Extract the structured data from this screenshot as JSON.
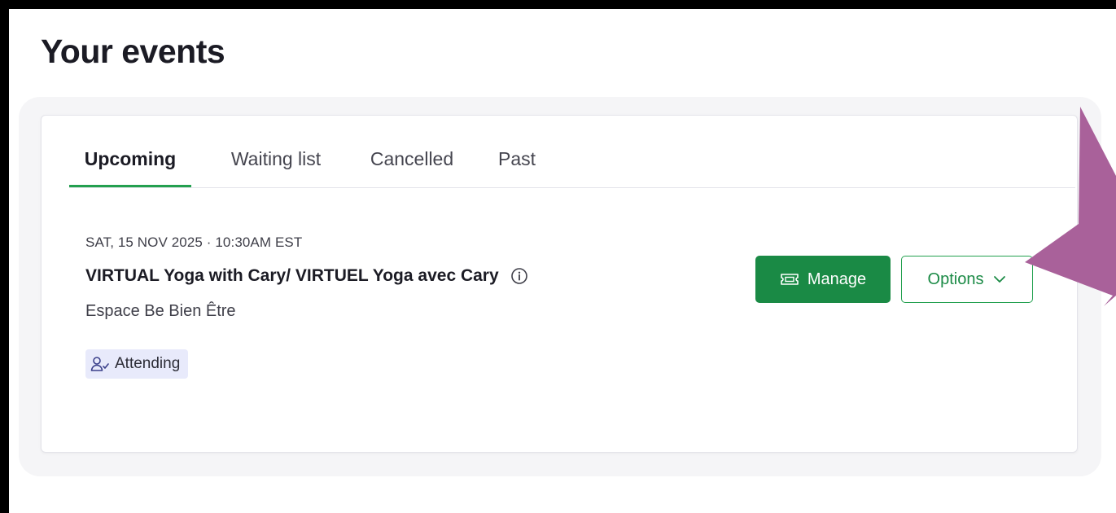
{
  "page": {
    "title": "Your events"
  },
  "tabs": [
    {
      "label": "Upcoming",
      "active": true
    },
    {
      "label": "Waiting list",
      "active": false
    },
    {
      "label": "Cancelled",
      "active": false
    },
    {
      "label": "Past",
      "active": false
    }
  ],
  "event": {
    "date": "SAT, 15 NOV 2025 · 10:30AM EST",
    "title": "VIRTUAL Yoga with Cary/ VIRTUEL Yoga avec Cary",
    "location": "Espace Be Bien Être",
    "status": "Attending",
    "info_icon": "info-circle-icon",
    "status_icon": "user-check-icon"
  },
  "actions": {
    "manage_label": "Manage",
    "manage_icon": "ticket-icon",
    "options_label": "Options",
    "options_icon": "chevron-down-icon"
  },
  "colors": {
    "accent_green": "#1a8a45",
    "tab_underline": "#23a04f",
    "badge_bg": "#e8eafb",
    "annotation_arrow": "#a9619a",
    "frame_border": "#000000"
  }
}
